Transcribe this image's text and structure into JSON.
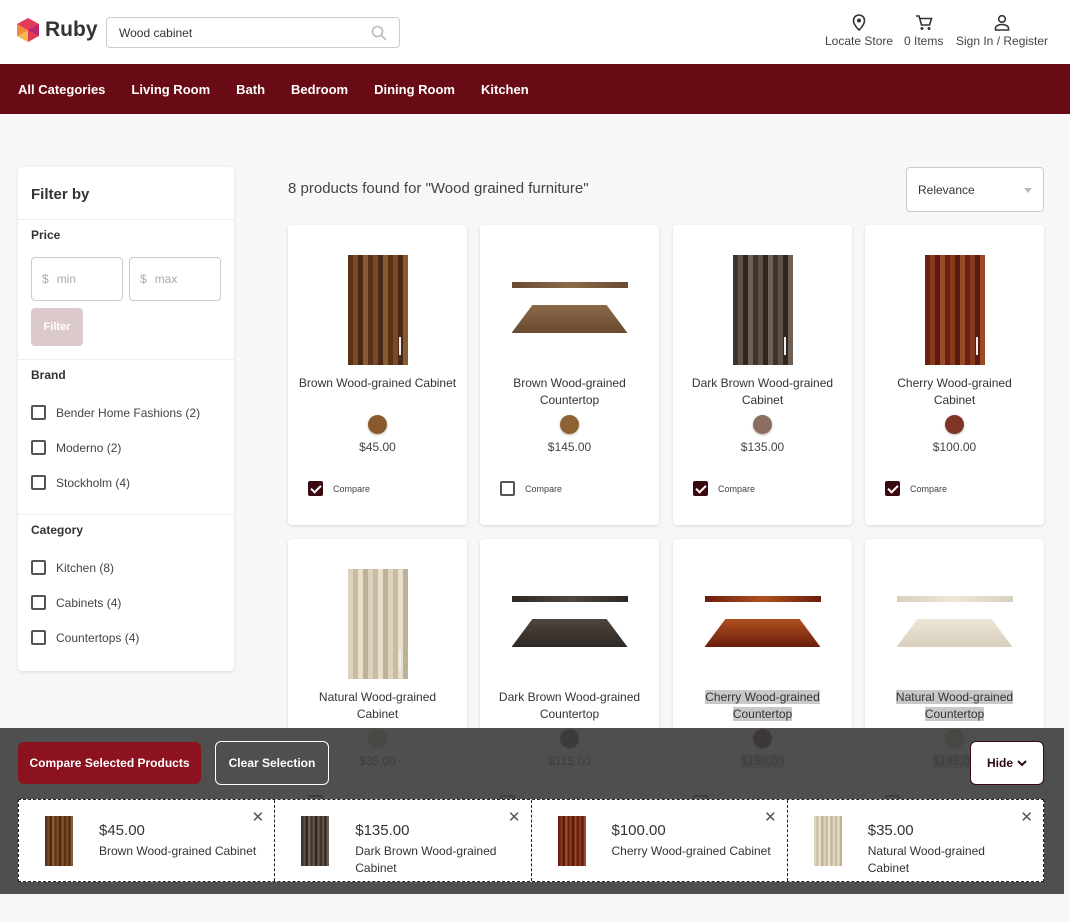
{
  "header": {
    "brand": "Ruby",
    "search_value": "Wood cabinet",
    "locate": "Locate Store",
    "cart": "0 Items",
    "signin": "Sign In / Register"
  },
  "nav": [
    "All Categories",
    "Living Room",
    "Bath",
    "Bedroom",
    "Dining Room",
    "Kitchen"
  ],
  "filter": {
    "title": "Filter by",
    "price_label": "Price",
    "min_placeholder": "min",
    "max_placeholder": "max",
    "currency": "$",
    "filter_button": "Filter",
    "brand_label": "Brand",
    "brands": [
      "Bender Home Fashions (2)",
      "Moderno (2)",
      "Stockholm (4)"
    ],
    "category_label": "Category",
    "categories": [
      "Kitchen (8)",
      "Cabinets (4)",
      "Countertops (4)"
    ]
  },
  "results_text": "8 products found for \"Wood grained furniture\"",
  "sort": "Relevance",
  "compare_label": "Compare",
  "products": [
    {
      "name": "Brown Wood-grained Cabinet",
      "price": "$45.00",
      "color": "#8a5a2e",
      "checked": true
    },
    {
      "name": "Brown Wood-grained Countertop",
      "price": "$145.00",
      "color": "#8f6234",
      "checked": false
    },
    {
      "name": "Dark Brown Wood-grained Cabinet",
      "price": "$135.00",
      "color": "#8b6d62",
      "checked": true
    },
    {
      "name": "Cherry Wood-grained Cabinet",
      "price": "$100.00",
      "color": "#7f3426",
      "checked": true
    },
    {
      "name": "Natural Wood-grained Cabinet",
      "price": "$35.00",
      "color": "#c4b496",
      "checked": false
    },
    {
      "name": "Dark Brown Wood-grained Countertop",
      "price": "$115.00",
      "color": "#3b3430",
      "checked": false
    },
    {
      "name": "Cherry Wood-grained Countertop",
      "price": "$160.00",
      "color": "#4a1712",
      "checked": false
    },
    {
      "name": "Natural Wood-grained Countertop",
      "price": "$145.00",
      "color": "#b8a88a",
      "checked": false
    }
  ],
  "compare_bar": {
    "compare_button": "Compare Selected Products",
    "clear_button": "Clear Selection",
    "hide_button": "Hide",
    "items": [
      {
        "price": "$45.00",
        "name": "Brown Wood-grained Cabinet"
      },
      {
        "price": "$135.00",
        "name": "Dark Brown Wood-grained Cabinet"
      },
      {
        "price": "$100.00",
        "name": "Cherry Wood-grained Cabinet"
      },
      {
        "price": "$35.00",
        "name": "Natural Wood-grained Cabinet"
      }
    ]
  }
}
